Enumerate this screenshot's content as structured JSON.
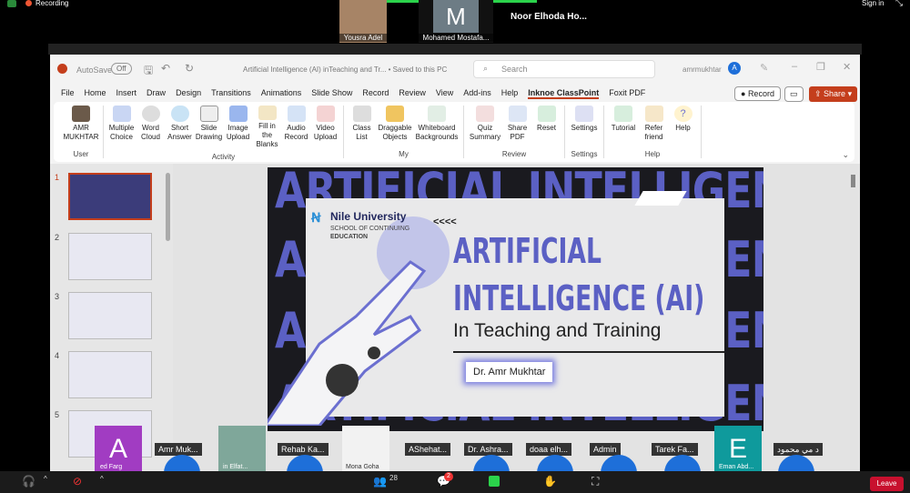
{
  "zoom": {
    "recording": "Recording",
    "sign_in": "Sign in",
    "participants_top": [
      "Yousra Adel",
      "Mohamed Mostafa...",
      "Noor Elhoda Ho..."
    ],
    "mohamed_initial": "M",
    "strip": [
      "Amr Muk...",
      "Rehab Ka...",
      "AShehat...",
      "Dr. Ashra...",
      "doaa elh...",
      "Admin",
      "Tarek Fa...",
      "د مي محمود"
    ],
    "strip_video_names": [
      "ed Farg",
      "in Elfat...",
      "Mona Goha",
      "Eman Abd..."
    ],
    "initial_a": "A",
    "initial_e": "E",
    "participants_count": "28",
    "chat_badge": "2",
    "leave": "Leave"
  },
  "ppt": {
    "autosave": "AutoSave",
    "autosave_state": "Off",
    "title": "Artificial Intelligence (AI) inTeaching and Tr...  •  Saved to this PC",
    "search_placeholder": "Search",
    "user": "amrmukhtar",
    "user_initial": "A",
    "menu": [
      "File",
      "Home",
      "Insert",
      "Draw",
      "Design",
      "Transitions",
      "Animations",
      "Slide Show",
      "Record",
      "Review",
      "View",
      "Add-ins",
      "Help",
      "Inknoe ClassPoint",
      "Foxit PDF"
    ],
    "active_tab": "Inknoe ClassPoint",
    "record_btn": "Record",
    "share_btn": "Share",
    "ribbon": [
      {
        "group": "User",
        "items": [
          "AMR MUKHTAR"
        ]
      },
      {
        "group": "Activity",
        "items": [
          "Multiple Choice",
          "Word Cloud",
          "Short Answer",
          "Slide Drawing",
          "Image Upload",
          "Fill in the Blanks",
          "Audio Record",
          "Video Upload"
        ]
      },
      {
        "group": "My",
        "items": [
          "Class List",
          "Draggable Objects",
          "Whiteboard Backgrounds"
        ]
      },
      {
        "group": "Review",
        "items": [
          "Quiz Summary",
          "Share PDF",
          "Reset"
        ]
      },
      {
        "group": "Settings",
        "items": [
          "Settings"
        ]
      },
      {
        "group": "Help",
        "items": [
          "Tutorial",
          "Refer friend",
          "Help"
        ]
      }
    ],
    "slide_numbers": [
      "1",
      "2",
      "3",
      "4",
      "5"
    ],
    "slide": {
      "bg_text": "ARTIFICIAL INTELLIGENCE (AI)",
      "logo_name": "Nile University",
      "logo_sub1": "SCHOOL OF CONTINUING",
      "logo_sub2": "EDUCATION",
      "chevrons": "<<<<",
      "title1": "ARTIFICIAL",
      "title2": "INTELLIGENCE (AI)",
      "subtitle": "In Teaching and Training",
      "presenter": "Dr. Amr Mukhtar"
    }
  },
  "colors": {
    "accent": "#5b60c4",
    "ppt_red": "#c43e1c",
    "leave": "#c8102e"
  }
}
